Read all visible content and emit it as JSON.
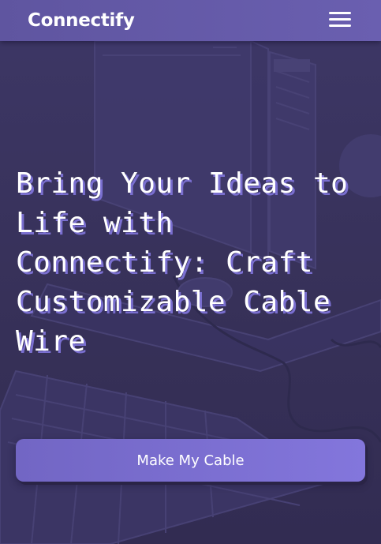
{
  "navbar": {
    "brand": "Connectify",
    "menu_icon": "hamburger-menu-icon"
  },
  "hero": {
    "title": "Bring Your Ideas to Life with Connectify: Craft Customizable Cable Wire",
    "cta_label": "Make My Cable"
  },
  "colors": {
    "background": "#3a3560",
    "navbar": "#6559a8",
    "accent": "#7a6fd0",
    "text": "#ffffff"
  }
}
